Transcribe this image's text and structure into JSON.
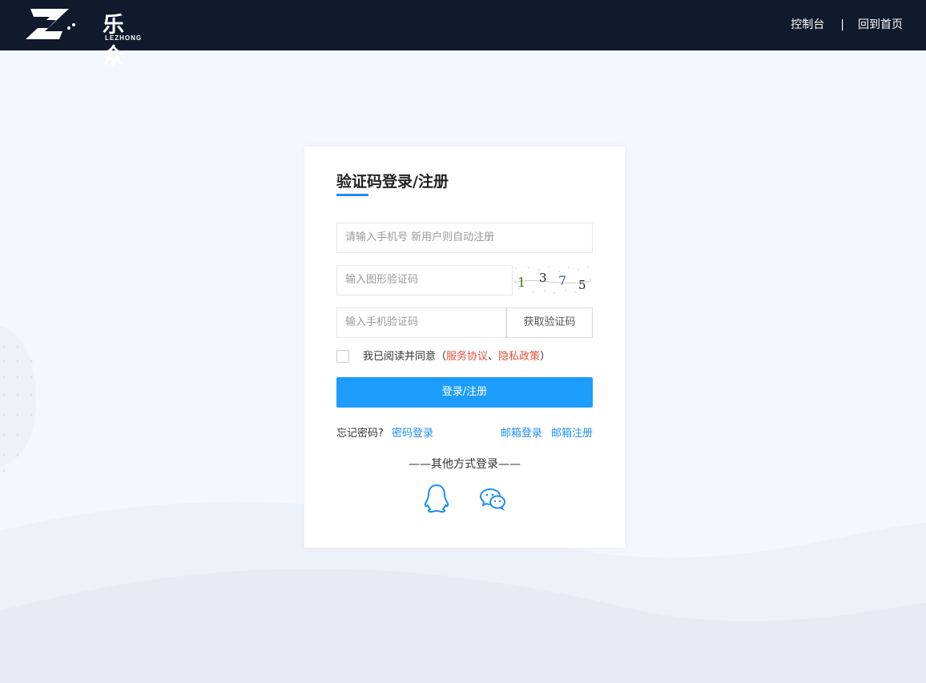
{
  "brand": {
    "name": "乐众",
    "sub": "LEZHONG"
  },
  "nav": {
    "console": "控制台",
    "separator": "|",
    "home": "回到首页"
  },
  "form": {
    "title": "验证码登录/注册",
    "phone_placeholder": "请输入手机号 新用户则自动注册",
    "image_code_placeholder": "输入图形验证码",
    "captcha_text": "1375",
    "sms_code_placeholder": "输入手机验证码",
    "get_code_label": "获取验证码",
    "agree_prefix": "我已阅读并同意（",
    "service_agreement": "服务协议",
    "agree_sep": "、",
    "privacy_policy": "隐私政策",
    "agree_suffix": "）",
    "agree_checked": false,
    "submit_label": "登录/注册",
    "forgot_password": "忘记密码?",
    "password_login": "密码登录",
    "email_login": "邮箱登录",
    "email_register": "邮箱注册",
    "other_methods": "——其他方式登录——",
    "social": [
      {
        "icon": "qq-icon"
      },
      {
        "icon": "wechat-icon"
      }
    ]
  },
  "colors": {
    "topbar": "#111a2c",
    "accent": "#1f8ff4",
    "submit": "#1d9dfb",
    "link_red": "#e2513d",
    "background": "#f4f7fb"
  }
}
